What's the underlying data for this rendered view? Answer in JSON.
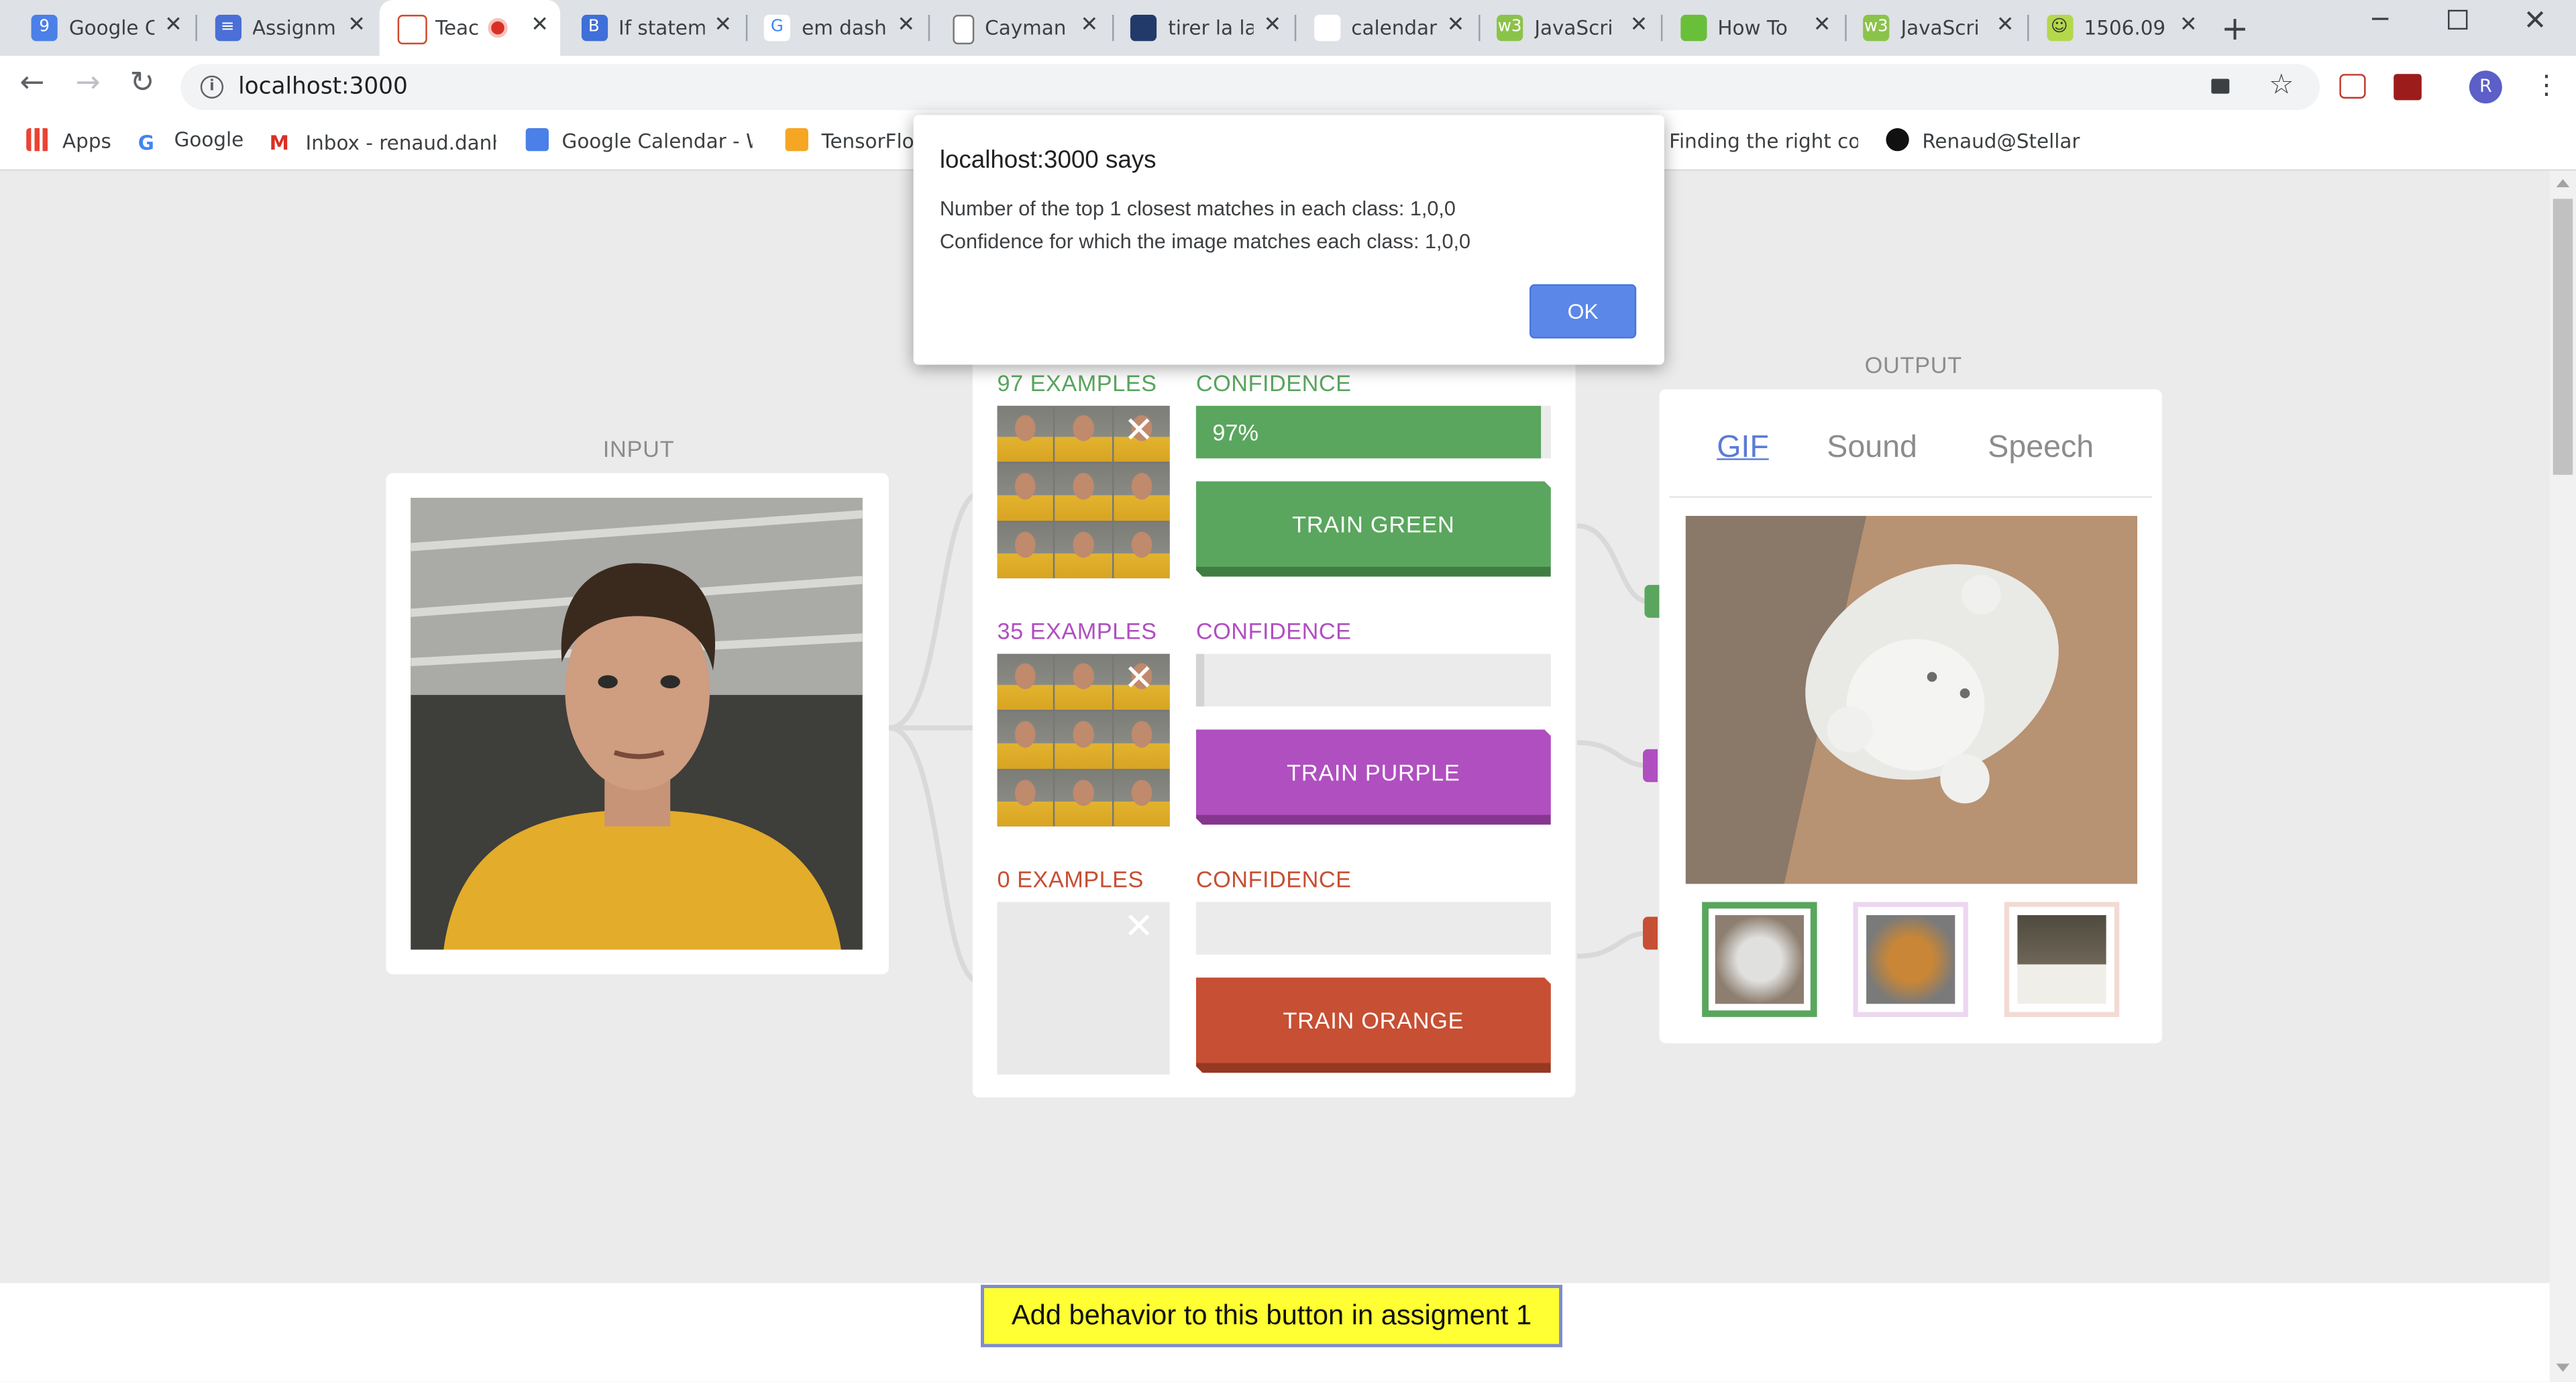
{
  "browser": {
    "tabs": [
      {
        "title": "Google C",
        "icon": "calendar-icon"
      },
      {
        "title": "Assignm",
        "icon": "docs-icon"
      },
      {
        "title": "Teac",
        "icon": "glitch-icon"
      },
      {
        "title": "If statem",
        "icon": "b-icon"
      },
      {
        "title": "em dash",
        "icon": "google-icon"
      },
      {
        "title": "Cayman",
        "icon": "file-icon"
      },
      {
        "title": "tirer la la",
        "icon": "linguee-icon"
      },
      {
        "title": "calendar",
        "icon": "github-icon"
      },
      {
        "title": "JavaScri",
        "icon": "w3-icon"
      },
      {
        "title": "How To",
        "icon": "twig-icon"
      },
      {
        "title": "JavaScri",
        "icon": "w3-icon"
      },
      {
        "title": "1506.09",
        "icon": "smiley-icon"
      }
    ],
    "url": "localhost:3000",
    "bookmarks": [
      {
        "label": "Apps",
        "icon": "apps-grid-icon"
      },
      {
        "label": "Google",
        "icon": "google-icon"
      },
      {
        "label": "Inbox - renaud.danha",
        "icon": "gmail-icon"
      },
      {
        "label": "Google Calendar - W",
        "icon": "calendar-icon"
      },
      {
        "label": "TensorFlo",
        "icon": "tensorflow-icon"
      },
      {
        "label": "Finding the right colo",
        "icon": "page-icon"
      },
      {
        "label": "Renaud@Stellar",
        "icon": "github-icon"
      }
    ],
    "profile_initial": "R"
  },
  "dialog": {
    "title": "localhost:3000 says",
    "line1": "Number of the top 1 closest matches in each class: 1,0,0",
    "line2": "Confidence for which the image matches each class: 1,0,0",
    "ok": "OK"
  },
  "input": {
    "label": "INPUT"
  },
  "learning": {
    "classes": [
      {
        "examples": "97 EXAMPLES",
        "confidence_label": "CONFIDENCE",
        "confidence": "97%",
        "confidence_fraction": 0.97,
        "button": "TRAIN GREEN",
        "color": "#5aa65e",
        "dark": "#3f7d43"
      },
      {
        "examples": "35 EXAMPLES",
        "confidence_label": "CONFIDENCE",
        "confidence": "",
        "confidence_fraction": 0.02,
        "button": "TRAIN PURPLE",
        "color": "#b04fc0",
        "dark": "#86368f"
      },
      {
        "examples": "0 EXAMPLES",
        "confidence_label": "CONFIDENCE",
        "confidence": "",
        "confidence_fraction": 0,
        "button": "TRAIN ORANGE",
        "color": "#c74f33",
        "dark": "#963822"
      }
    ]
  },
  "output": {
    "label": "OUTPUT",
    "tabs": [
      "GIF",
      "Sound",
      "Speech"
    ],
    "active_tab": "GIF"
  },
  "footer": {
    "button": "Add behavior to this button in assigment 1"
  }
}
